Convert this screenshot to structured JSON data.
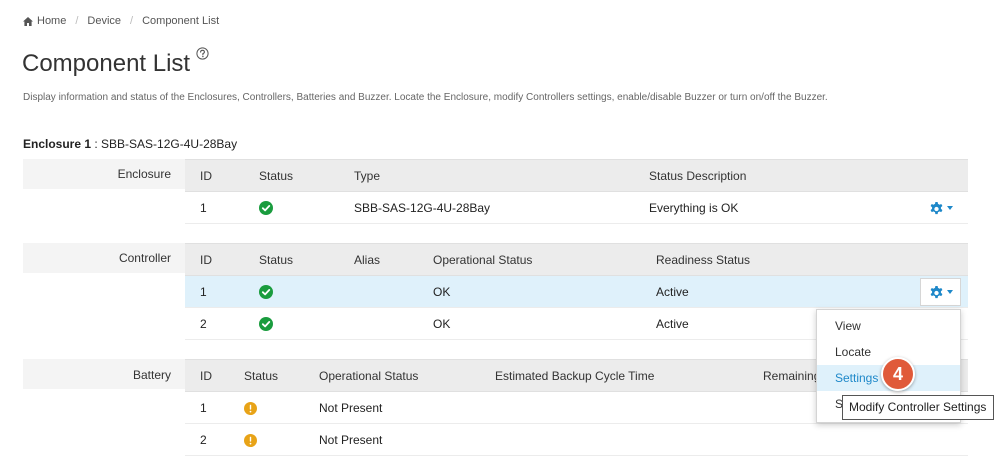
{
  "breadcrumb": {
    "home": "Home",
    "device": "Device",
    "current": "Component List"
  },
  "page": {
    "title": "Component List",
    "description": "Display information and status of the Enclosures, Controllers, Batteries and Buzzer. Locate the Enclosure, modify Controllers settings, enable/disable Buzzer or turn on/off the Buzzer."
  },
  "enclosure_title": {
    "label": "Enclosure 1",
    "value": " : SBB-SAS-12G-4U-28Bay"
  },
  "enclosure_section": {
    "label": "Enclosure",
    "headers": [
      "ID",
      "Status",
      "Type",
      "Status Description"
    ],
    "rows": [
      {
        "id": "1",
        "status": "ok",
        "type": "SBB-SAS-12G-4U-28Bay",
        "description": "Everything is OK"
      }
    ]
  },
  "controller_section": {
    "label": "Controller",
    "headers": [
      "ID",
      "Status",
      "Alias",
      "Operational Status",
      "Readiness Status"
    ],
    "rows": [
      {
        "id": "1",
        "status": "ok",
        "alias": "",
        "operational": "OK",
        "readiness": "Active"
      },
      {
        "id": "2",
        "status": "ok",
        "alias": "",
        "operational": "OK",
        "readiness": "Active"
      }
    ]
  },
  "battery_section": {
    "label": "Battery",
    "headers": [
      "ID",
      "Status",
      "Operational Status",
      "Estimated Backup Cycle Time",
      "Remaining"
    ],
    "rows": [
      {
        "id": "1",
        "status": "warning",
        "operational": "Not Present"
      },
      {
        "id": "2",
        "status": "warning",
        "operational": "Not Present"
      }
    ]
  },
  "dropdown_menu": {
    "items": [
      "View",
      "Locate",
      "Settings",
      "S"
    ],
    "active_item": "Settings"
  },
  "step_badge": "4",
  "tooltip": "Modify Controller Settings",
  "colors": {
    "accent": "#1e88c9",
    "ok": "#1a9c3e",
    "warning": "#e8a317",
    "badge": "#e05a3a",
    "selected_row": "#dff1fb"
  },
  "icons": {
    "home": "home-icon",
    "help": "help-circle-icon",
    "gear": "gear-icon",
    "ok": "check-circle-icon",
    "warning": "exclamation-circle-icon"
  }
}
